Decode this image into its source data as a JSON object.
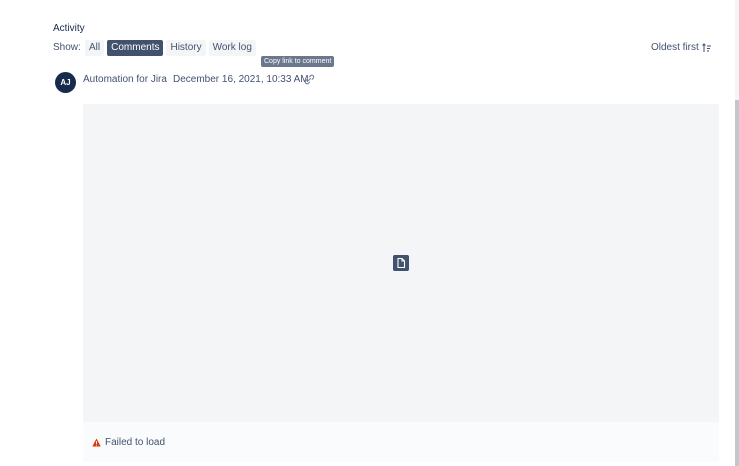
{
  "activity": {
    "heading": "Activity",
    "show_label": "Show:",
    "filters": [
      {
        "label": "All",
        "active": false
      },
      {
        "label": "Comments",
        "active": true
      },
      {
        "label": "History",
        "active": false
      },
      {
        "label": "Work log",
        "active": false
      }
    ],
    "sort_label": "Oldest first",
    "sort_icon": "sort-ascending-icon"
  },
  "tooltip": "Copy link to comment",
  "comment": {
    "avatar_initials": "AJ",
    "author": "Automation for Jira",
    "timestamp": "December 16, 2021, 10:33 AM",
    "link_icon": "link-icon",
    "attachment_icon": "document-icon",
    "error_text": "Failed to load",
    "error_icon": "warning-icon"
  },
  "colors": {
    "active_filter": "#42526e",
    "avatar_bg": "#172b4d",
    "warning": "#de350b",
    "media_bg": "#f4f5f7"
  }
}
